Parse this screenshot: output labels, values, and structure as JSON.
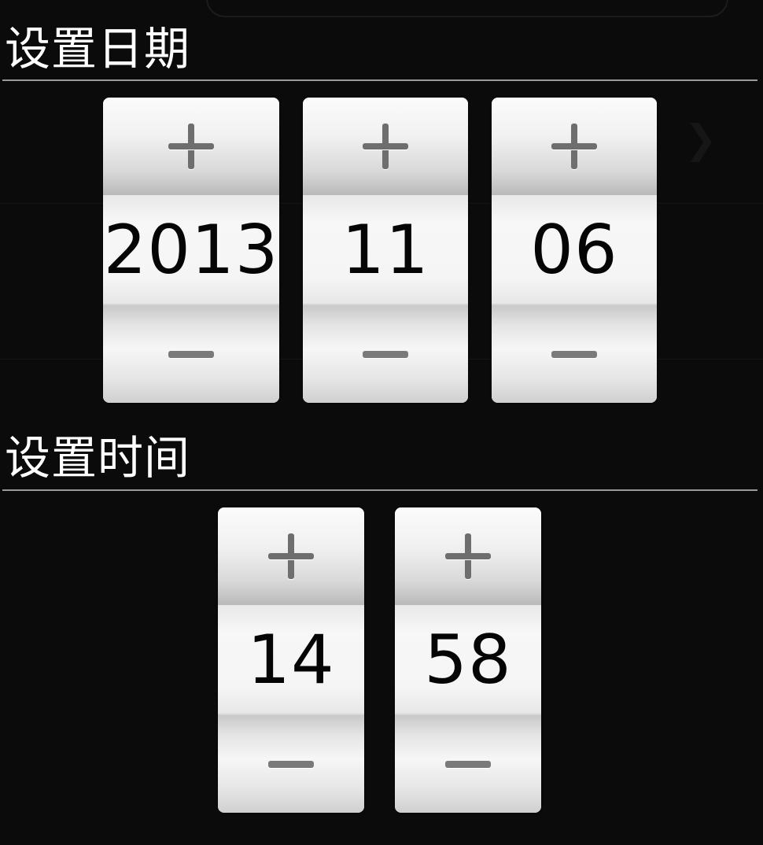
{
  "date_section": {
    "title": "设置日期",
    "pickers": [
      {
        "name": "year",
        "value": "2013"
      },
      {
        "name": "month",
        "value": "11"
      },
      {
        "name": "day",
        "value": "06"
      }
    ]
  },
  "time_section": {
    "title": "设置时间",
    "pickers": [
      {
        "name": "hour",
        "value": "14"
      },
      {
        "name": "minute",
        "value": "58"
      }
    ]
  },
  "icons": {
    "increment": "plus-icon",
    "decrement": "minus-icon"
  },
  "colors": {
    "background": "#0b0b0b",
    "title_text": "#ffffff",
    "divider": "#9a9a9a",
    "value_text": "#050505"
  }
}
